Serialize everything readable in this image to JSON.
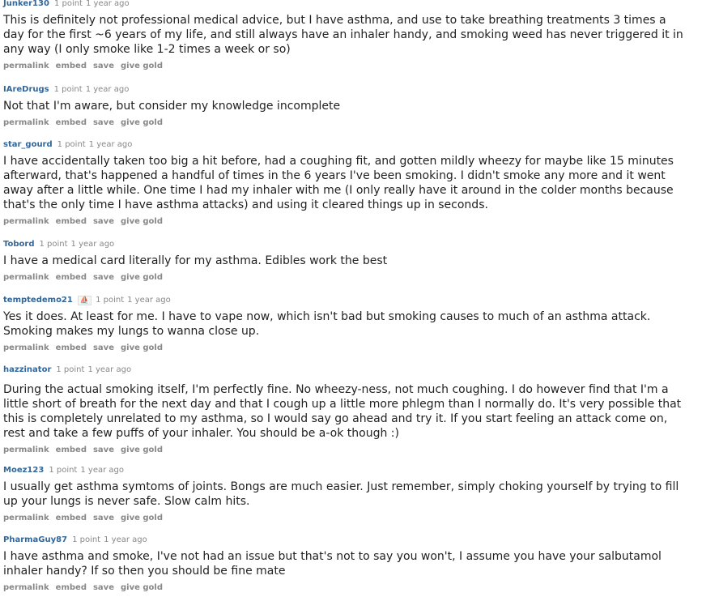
{
  "comments": [
    {
      "author": "Junker130",
      "score": "1 point",
      "time": "1 year ago",
      "body": "This is definitely not professional medical advice, but I have asthma, and use to take breathing treatments 3 times a day for the first ~6 years of my life, and still always have an inhaler handy, and smoking weed has never triggered it in any way (I only smoke like 1-2 times a week or so)"
    },
    {
      "author": "IAreDrugs",
      "score": "1 point",
      "time": "1 year ago",
      "body": "Not that I'm aware, but consider my knowledge incomplete"
    },
    {
      "author": "star_gourd",
      "score": "1 point",
      "time": "1 year ago",
      "body": "I have accidentally taken too big a hit before, had a coughing fit, and gotten mildly wheezy for maybe like 15 minutes afterward, that's happened a handful of times in the 6 years I've been smoking. I didn't smoke any more and it went away after a little while. One time I had my inhaler with me (I only really have it around in the colder months because that's the only time I have asthma attacks) and using it cleared things up in seconds."
    },
    {
      "author": "Tobord",
      "score": "1 point",
      "time": "1 year ago",
      "body": "I have a medical card literally for my asthma. Edibles work the best"
    },
    {
      "author": "temptedemo21",
      "flair": "⛵",
      "score": "1 point",
      "time": "1 year ago",
      "body": "Yes it does. At least for me. I have to vape now, which isn't bad but smoking causes to much of an asthma attack. Smoking makes my lungs to wanna close up."
    },
    {
      "author": "hazzinator",
      "score": "1 point",
      "time": "1 year ago",
      "body": "During the actual smoking itself, I'm perfectly fine. No wheezy-ness, not much coughing. I do however find that I'm a little short of breath for the next day and that I cough up a little more phlegm than I normally do. It's very possible that this is completely unrelated to my asthma, so I would say go ahead and try it. If you start feeling an attack come on, rest and take a few puffs of your inhaler. You should be a-ok though :)"
    },
    {
      "author": "Moez123",
      "score": "1 point",
      "time": "1 year ago",
      "body": "I usually get asthma symtoms of joints. Bongs are much easier. Just remember, simply choking yourself by trying to fill up your lungs is never safe. Slow calm hits."
    },
    {
      "author": "PharmaGuy87",
      "score": "1 point",
      "time": "1 year ago",
      "body": "I have asthma and smoke, I've not had an issue but that's not to say you won't, I assume you have your salbutamol inhaler handy? If so then you should be fine mate"
    }
  ],
  "actions": {
    "permalink": "permalink",
    "embed": "embed",
    "save": "save",
    "give_gold": "give gold"
  }
}
